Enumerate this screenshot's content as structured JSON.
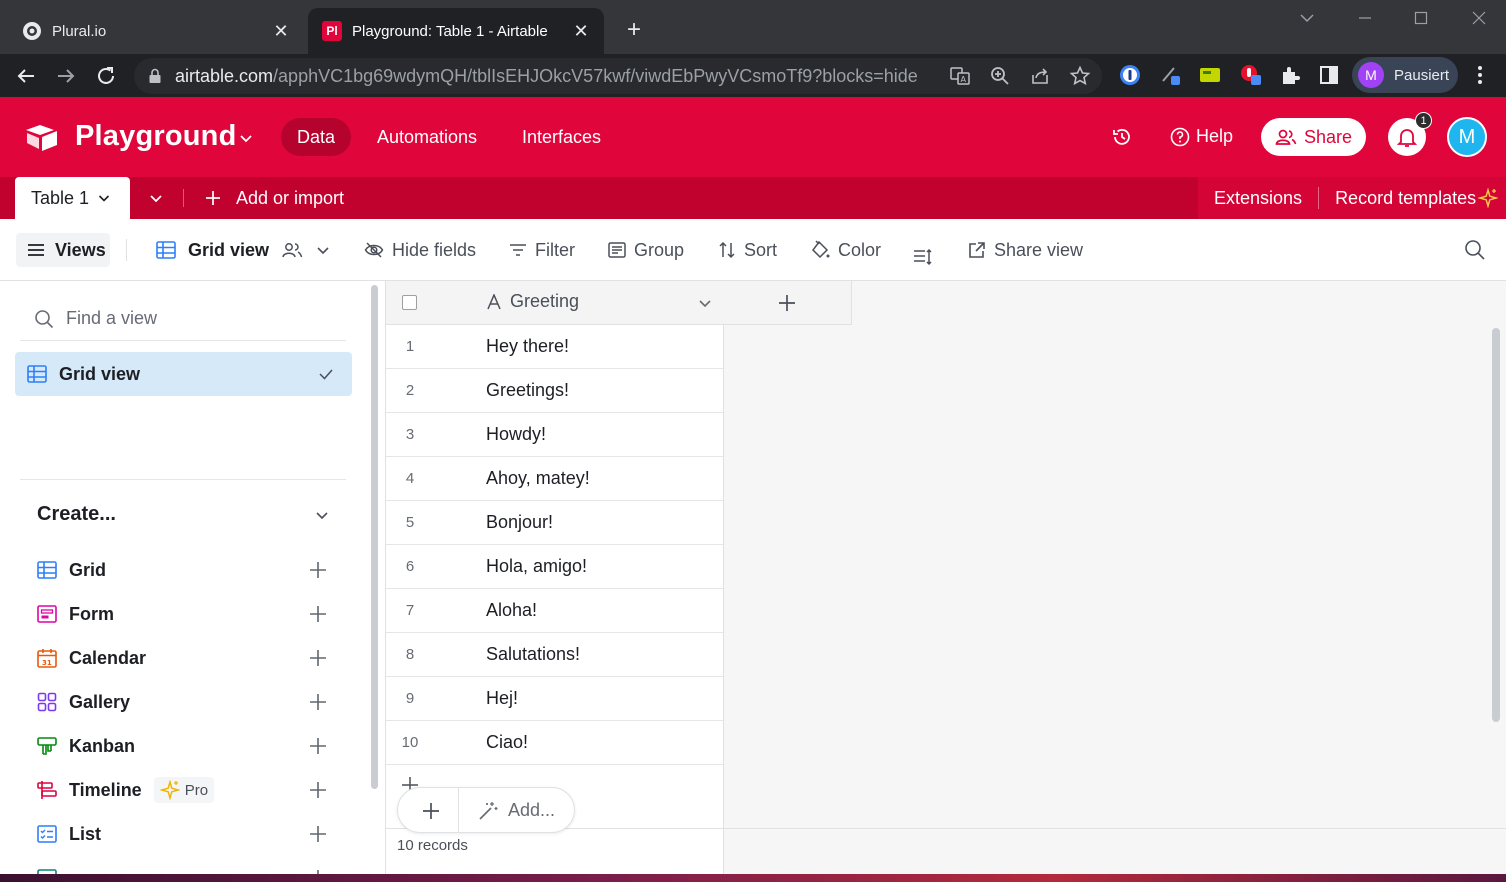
{
  "browser": {
    "tabs": [
      {
        "title": "Plural.io",
        "active": false
      },
      {
        "title": "Playground: Table 1 - Airtable",
        "active": true,
        "favicon_text": "Pl"
      }
    ],
    "url_host": "airtable.com",
    "url_path": "/apphVC1bg69wdymQH/tblIsEHJOkcV57kwf/viwdEbPwyVCsmoTf9?blocks=hide",
    "profile_initial": "M",
    "profile_name": "Pausiert"
  },
  "header": {
    "base_name": "Playground",
    "nav": [
      {
        "label": "Data",
        "selected": true
      },
      {
        "label": "Automations",
        "selected": false
      },
      {
        "label": "Interfaces",
        "selected": false
      }
    ],
    "help_label": "Help",
    "share_label": "Share",
    "notification_count": "1",
    "user_initial": "M",
    "accent_color": "#e0063c"
  },
  "tablebar": {
    "table_name": "Table 1",
    "add_import_label": "Add or import",
    "extensions_label": "Extensions",
    "record_templates_label": "Record templates"
  },
  "viewbar": {
    "views_label": "Views",
    "grid_view_label": "Grid view",
    "hide_fields_label": "Hide fields",
    "filter_label": "Filter",
    "group_label": "Group",
    "sort_label": "Sort",
    "color_label": "Color",
    "share_view_label": "Share view"
  },
  "sidebar": {
    "search_placeholder": "Find a view",
    "current_view": "Grid view",
    "create_title": "Create...",
    "create_items": [
      {
        "label": "Grid",
        "icon": "grid-icon"
      },
      {
        "label": "Form",
        "icon": "form-icon"
      },
      {
        "label": "Calendar",
        "icon": "calendar-icon"
      },
      {
        "label": "Gallery",
        "icon": "gallery-icon"
      },
      {
        "label": "Kanban",
        "icon": "kanban-icon"
      },
      {
        "label": "Timeline",
        "icon": "timeline-icon",
        "badge": "Pro"
      },
      {
        "label": "List",
        "icon": "list-icon"
      }
    ]
  },
  "grid": {
    "field_name": "Greeting",
    "rows": [
      {
        "num": "1",
        "value": "Hey there!"
      },
      {
        "num": "2",
        "value": "Greetings!"
      },
      {
        "num": "3",
        "value": "Howdy!"
      },
      {
        "num": "4",
        "value": "Ahoy, matey!"
      },
      {
        "num": "5",
        "value": "Bonjour!"
      },
      {
        "num": "6",
        "value": "Hola, amigo!"
      },
      {
        "num": "7",
        "value": "Aloha!"
      },
      {
        "num": "8",
        "value": "Salutations!"
      },
      {
        "num": "9",
        "value": "Hej!"
      },
      {
        "num": "10",
        "value": "Ciao!"
      }
    ],
    "add_label": "Add...",
    "record_count": "10 records"
  }
}
